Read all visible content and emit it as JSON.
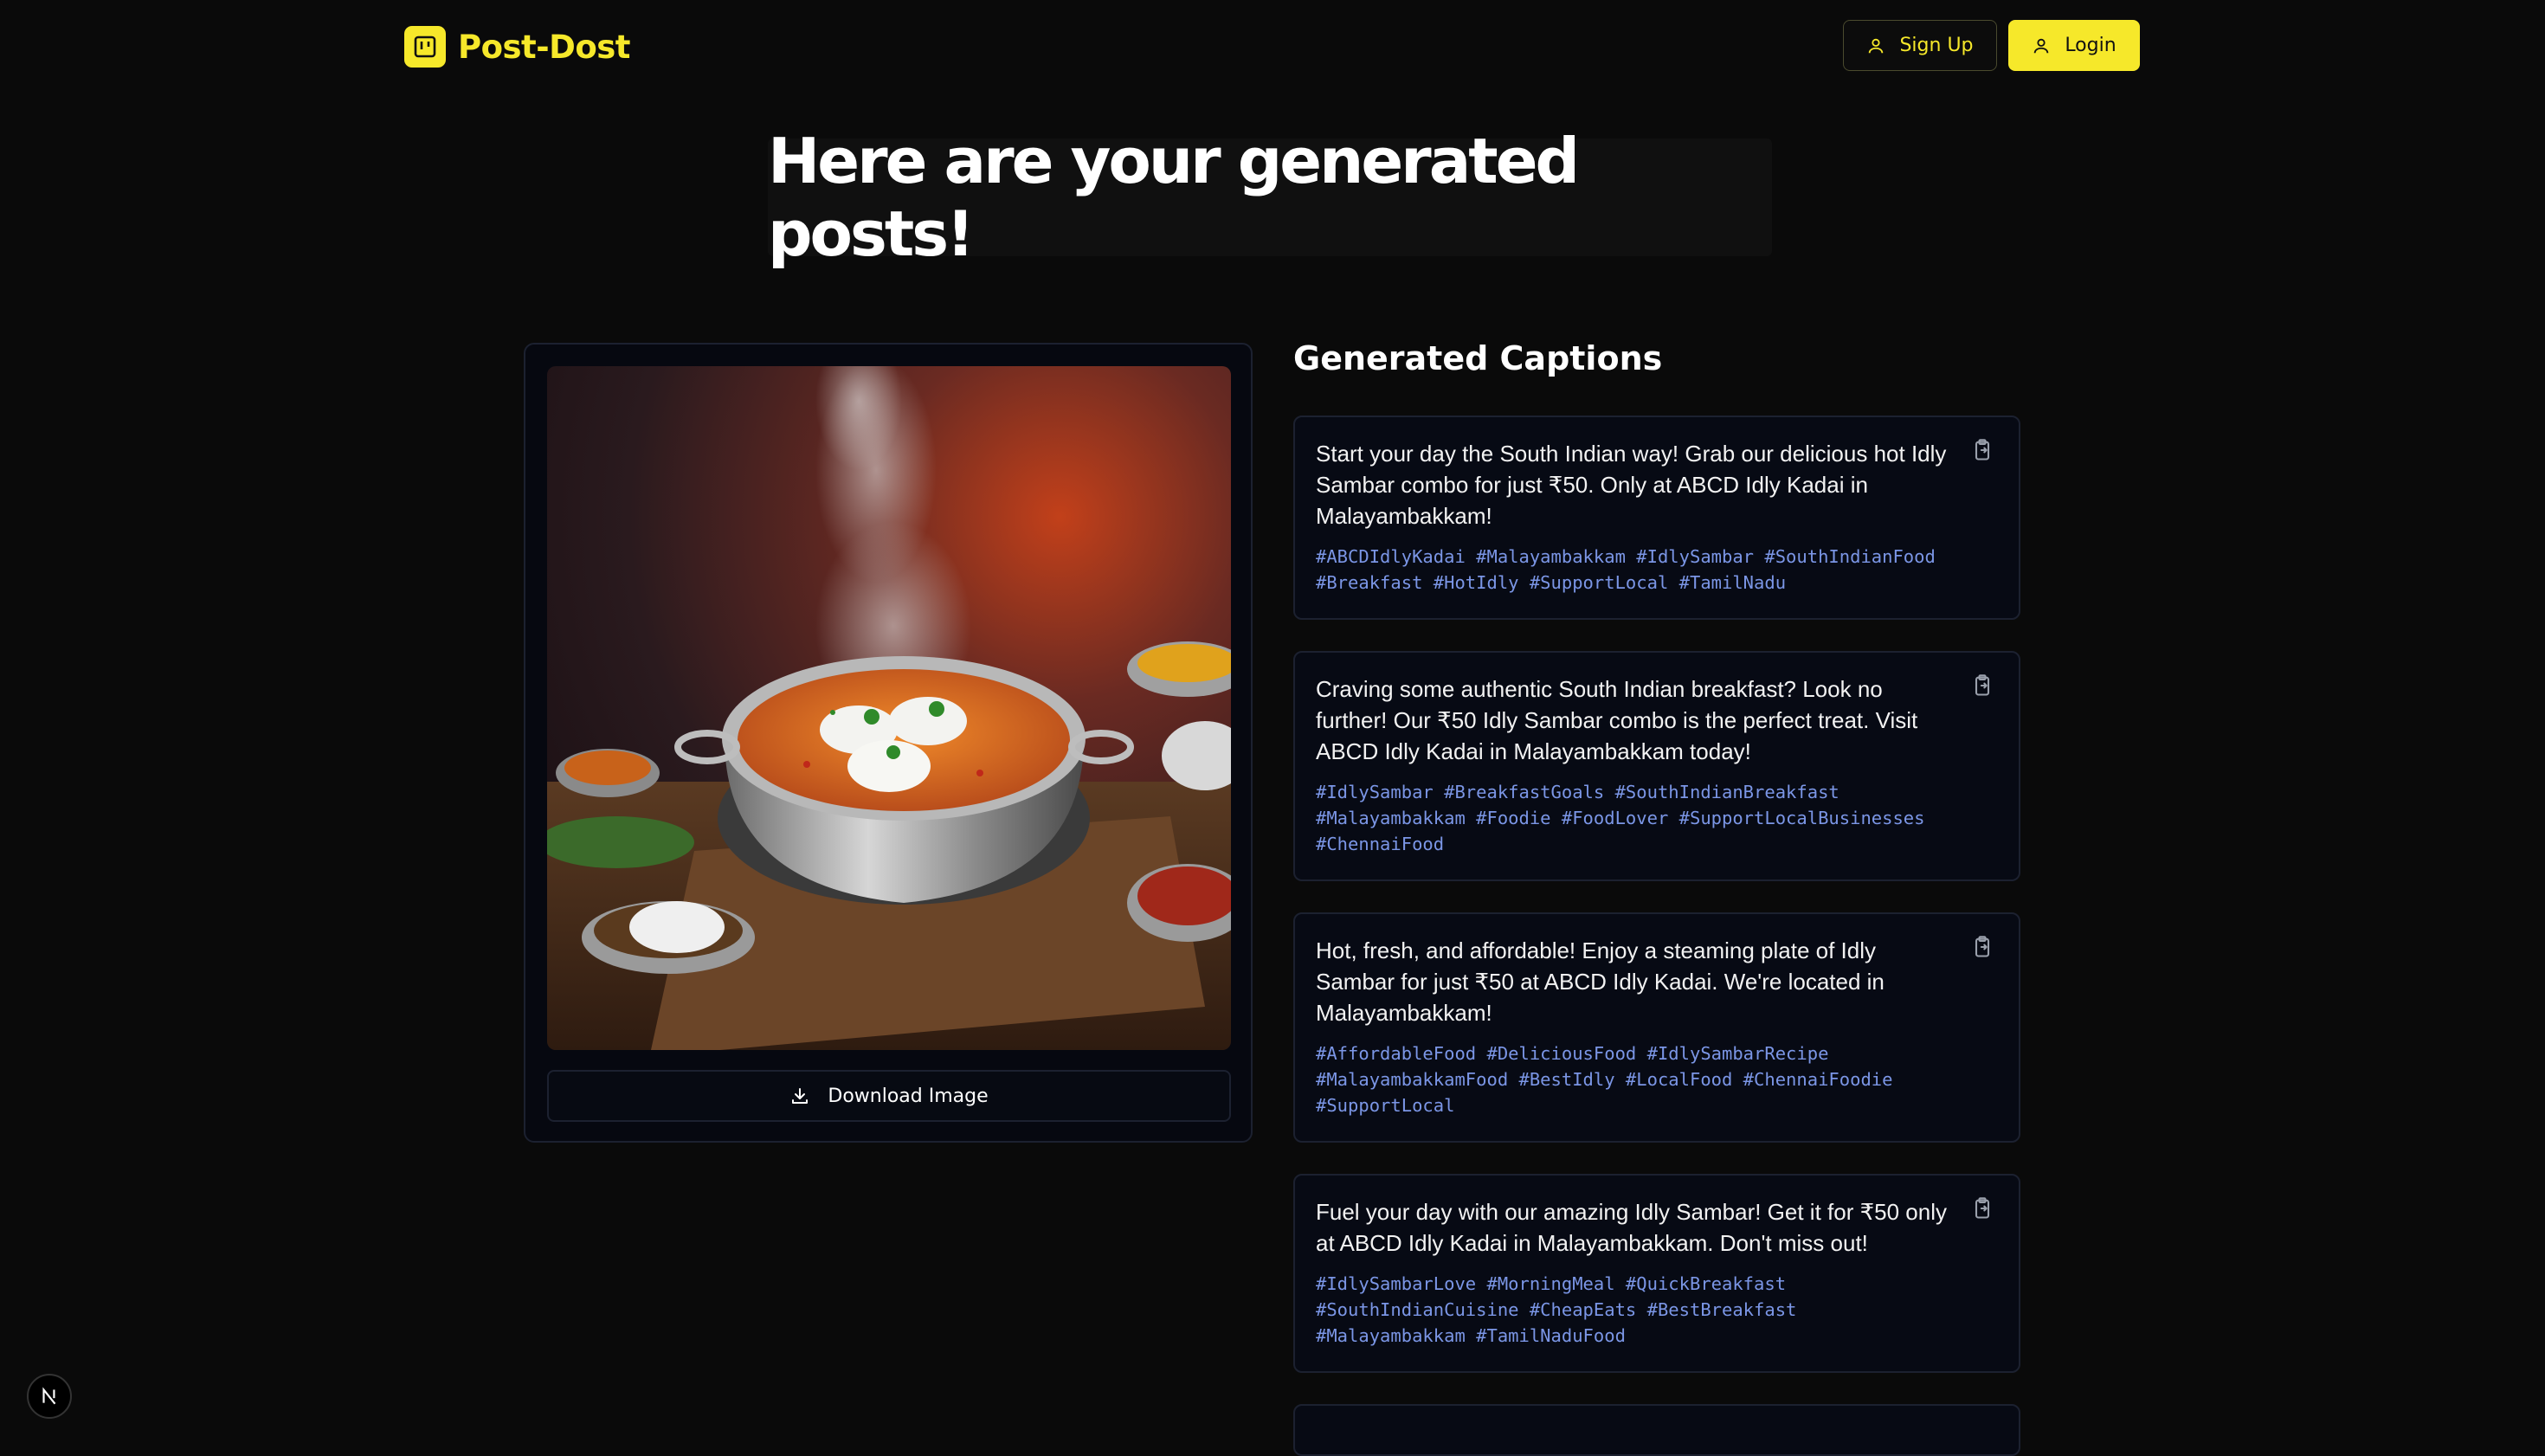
{
  "brand": {
    "name": "Post-Dost"
  },
  "nav": {
    "signup_label": "Sign Up",
    "login_label": "Login"
  },
  "hero": {
    "title": "Here are your generated posts!"
  },
  "image_card": {
    "download_label": "Download Image"
  },
  "captions": {
    "heading": "Generated Captions",
    "items": [
      {
        "text": "Start your day the South Indian way! Grab our delicious hot Idly Sambar combo for just ₹50. Only at ABCD Idly Kadai in Malayambakkam!",
        "tags": "#ABCDIdlyKadai #Malayambakkam #IdlySambar #SouthIndianFood #Breakfast #HotIdly #SupportLocal #TamilNadu"
      },
      {
        "text": "Craving some authentic South Indian breakfast? Look no further! Our ₹50 Idly Sambar combo is the perfect treat. Visit ABCD Idly Kadai in Malayambakkam today!",
        "tags": "#IdlySambar #BreakfastGoals #SouthIndianBreakfast #Malayambakkam #Foodie #FoodLover #SupportLocalBusinesses #ChennaiFood"
      },
      {
        "text": "Hot, fresh, and affordable! Enjoy a steaming plate of Idly Sambar for just ₹50 at ABCD Idly Kadai. We're located in Malayambakkam!",
        "tags": "#AffordableFood #DeliciousFood #IdlySambarRecipe #MalayambakkamFood #BestIdly #LocalFood #ChennaiFoodie #SupportLocal"
      },
      {
        "text": "Fuel your day with our amazing Idly Sambar! Get it for ₹50 only at ABCD Idly Kadai in Malayambakkam. Don't miss out!",
        "tags": "#IdlySambarLove #MorningMeal #QuickBreakfast #SouthIndianCuisine #CheapEats #BestBreakfast #Malayambakkam #TamilNaduFood"
      }
    ]
  },
  "colors": {
    "accent": "#f6e82a",
    "background": "#0a0a0a",
    "hashtag": "#7b96e6"
  },
  "icons": {
    "brand": "logo-icon",
    "signup": "user-icon",
    "login": "user-icon",
    "download": "download-icon",
    "copy": "clipboard-copy-icon",
    "framework": "nextjs-icon"
  }
}
